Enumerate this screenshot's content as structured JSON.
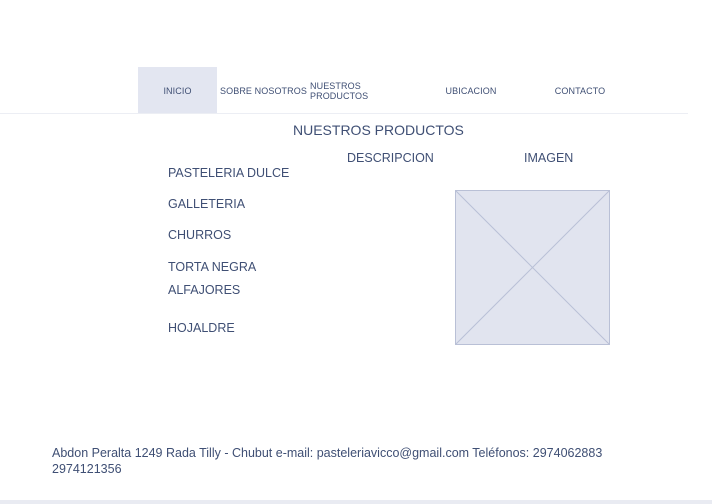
{
  "nav": {
    "items": [
      {
        "label": "INICIO",
        "active": true
      },
      {
        "label": "SOBRE NOSOTROS",
        "active": false
      },
      {
        "label": "NUESTROS PRODUCTOS",
        "active": false
      },
      {
        "label": "UBICACION",
        "active": false
      },
      {
        "label": "CONTACTO",
        "active": false
      }
    ]
  },
  "main": {
    "title": "NUESTROS PRODUCTOS",
    "columns": {
      "description": "DESCRIPCION",
      "image": "IMAGEN"
    },
    "products": [
      "PASTELERIA DULCE",
      "GALLETERIA",
      "CHURROS",
      "TORTA NEGRA",
      "ALFAJORES",
      "HOJALDRE"
    ],
    "image_placeholder_icon": "image-placeholder-icon"
  },
  "footer": {
    "text": "Abdon Peralta 1249 Rada Tilly - Chubut e-mail: pasteleriavicco@gmail.com Teléfonos: 2974062883 2974121356"
  },
  "colors": {
    "text": "#3f4f74",
    "nav_active_bg": "#e3e6f1",
    "placeholder_fill": "#e1e4ef",
    "placeholder_stroke": "#b9c0d6"
  }
}
